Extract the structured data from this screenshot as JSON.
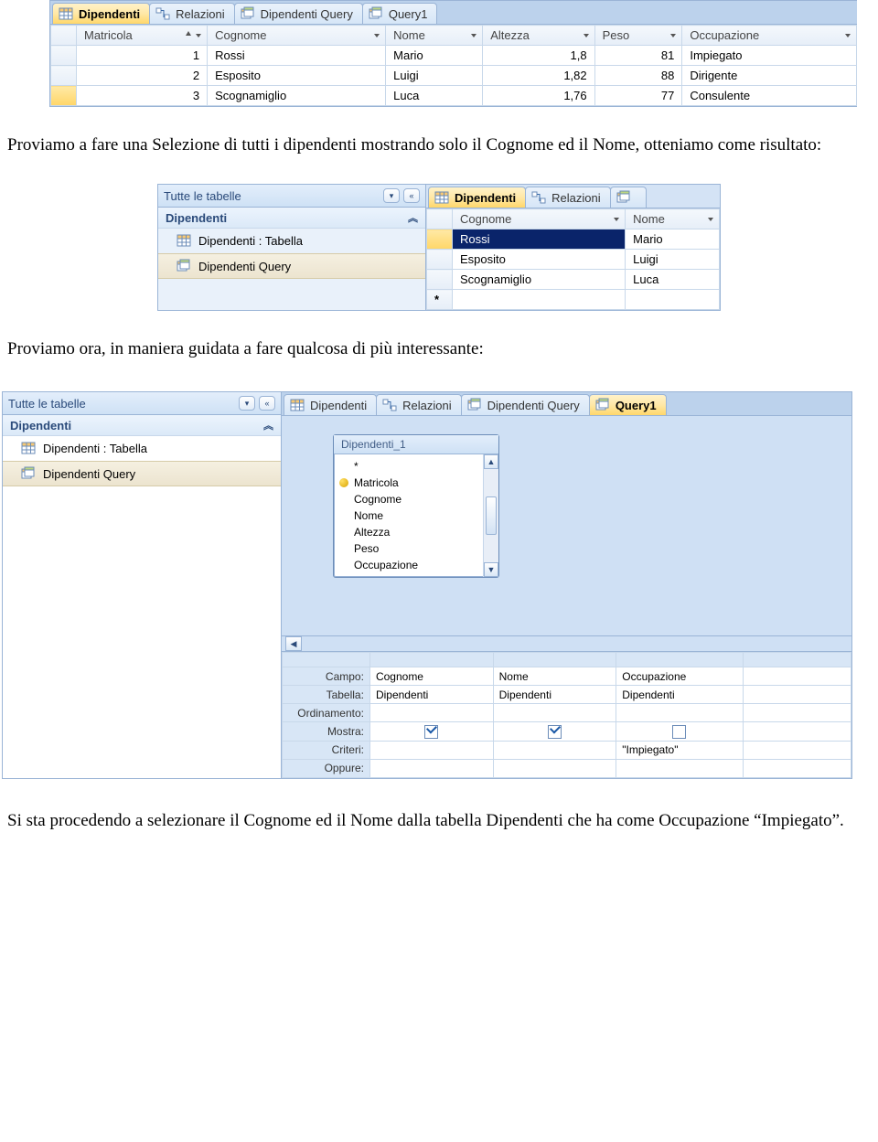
{
  "fig1": {
    "tabs": [
      {
        "label": "Dipendenti",
        "icon": "table",
        "active": true
      },
      {
        "label": "Relazioni",
        "icon": "relation",
        "active": false
      },
      {
        "label": "Dipendenti Query",
        "icon": "query",
        "active": false
      },
      {
        "label": "Query1",
        "icon": "query",
        "active": false
      }
    ],
    "columns": [
      "Matricola",
      "Cognome",
      "Nome",
      "Altezza",
      "Peso",
      "Occupazione"
    ],
    "rows": [
      {
        "Matricola": "1",
        "Cognome": "Rossi",
        "Nome": "Mario",
        "Altezza": "1,8",
        "Peso": "81",
        "Occupazione": "Impiegato"
      },
      {
        "Matricola": "2",
        "Cognome": "Esposito",
        "Nome": "Luigi",
        "Altezza": "1,82",
        "Peso": "88",
        "Occupazione": "Dirigente"
      },
      {
        "Matricola": "3",
        "Cognome": "Scognamiglio",
        "Nome": "Luca",
        "Altezza": "1,76",
        "Peso": "77",
        "Occupazione": "Consulente"
      }
    ]
  },
  "para1": "Proviamo a fare una Selezione di tutti i dipendenti mostrando solo il Cognome ed il Nome, otteniamo come risultato:",
  "fig2": {
    "nav": {
      "header": "Tutte le tabelle",
      "group": "Dipendenti",
      "items": [
        {
          "label": "Dipendenti : Tabella",
          "icon": "table",
          "selected": false
        },
        {
          "label": "Dipendenti Query",
          "icon": "query",
          "selected": true
        }
      ]
    },
    "tabs": [
      {
        "label": "Dipendenti",
        "icon": "table",
        "active": true
      },
      {
        "label": "Relazioni",
        "icon": "relation",
        "active": false
      },
      {
        "label": "",
        "icon": "query",
        "active": false
      }
    ],
    "columns": [
      "Cognome",
      "Nome"
    ],
    "rows": [
      {
        "Cognome": "Rossi",
        "Nome": "Mario",
        "firstSelected": true
      },
      {
        "Cognome": "Esposito",
        "Nome": "Luigi"
      },
      {
        "Cognome": "Scognamiglio",
        "Nome": "Luca"
      }
    ]
  },
  "para2": "Proviamo ora, in maniera guidata a fare qualcosa di più interessante:",
  "fig3": {
    "nav": {
      "header": "Tutte le tabelle",
      "group": "Dipendenti",
      "items": [
        {
          "label": "Dipendenti : Tabella",
          "icon": "table",
          "selected": false
        },
        {
          "label": "Dipendenti Query",
          "icon": "query",
          "selected": true
        }
      ]
    },
    "tabs": [
      {
        "label": "Dipendenti",
        "icon": "table",
        "active": false
      },
      {
        "label": "Relazioni",
        "icon": "relation",
        "active": false
      },
      {
        "label": "Dipendenti Query",
        "icon": "query",
        "active": false
      },
      {
        "label": "Query1",
        "icon": "query",
        "active": true
      }
    ],
    "tablebox": {
      "title": "Dipendenti_1",
      "fields": [
        "*",
        "Matricola",
        "Cognome",
        "Nome",
        "Altezza",
        "Peso",
        "Occupazione"
      ],
      "keyField": "Matricola"
    },
    "grid": {
      "rowLabels": [
        "Campo:",
        "Tabella:",
        "Ordinamento:",
        "Mostra:",
        "Criteri:",
        "Oppure:"
      ],
      "cols": [
        {
          "Campo": "Cognome",
          "Tabella": "Dipendenti",
          "Mostra": true,
          "Criteri": ""
        },
        {
          "Campo": "Nome",
          "Tabella": "Dipendenti",
          "Mostra": true,
          "Criteri": ""
        },
        {
          "Campo": "Occupazione",
          "Tabella": "Dipendenti",
          "Mostra": false,
          "Criteri": "\"Impiegato\""
        }
      ]
    }
  },
  "para3": "Si sta procedendo a selezionare il Cognome ed il Nome dalla tabella Dipendenti che ha come Occupazione “Impiegato”."
}
